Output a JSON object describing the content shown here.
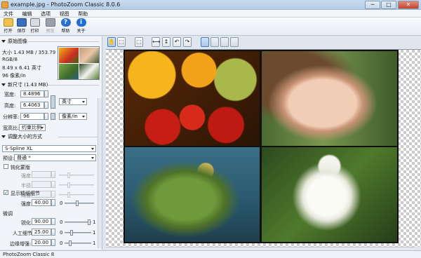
{
  "window": {
    "title": "example.jpg - PhotoZoom Classic 8.0.6",
    "min_glyph": "─",
    "max_glyph": "□",
    "close_glyph": "✕"
  },
  "menu": [
    "文件",
    "编辑",
    "选项",
    "视图",
    "帮助"
  ],
  "toolbar": {
    "open": "打开",
    "save": "保存",
    "print": "打印",
    "preview": "预览",
    "help": "帮助",
    "about": "关于",
    "help_glyph": "?",
    "about_glyph": "i"
  },
  "original_image": {
    "header": "原始图像",
    "size": "大小 1.43 MB / 353.79 KB",
    "mode": "RGB/8",
    "dimensions": "8.49 x 6.41 英寸",
    "resolution": "96 像素/in"
  },
  "new_size": {
    "header": "新尺寸 (1.43 MB)",
    "width_label": "宽度:",
    "width_value": "8.4896",
    "height_label": "高度:",
    "height_value": "6.4063",
    "resolution_label": "分辨率:",
    "resolution_value": "96",
    "unit": "英寸",
    "res_unit": "像素/in",
    "aspect_label": "宽高比:",
    "aspect_value": "约束比例"
  },
  "resize_method": {
    "header": "调整大小的方式",
    "method": "S-Spline XL",
    "preset_label": "预设:",
    "preset_value": "普通 *"
  },
  "sharpen": {
    "unsharp_label": "钝化蒙版",
    "strength_label": "强度:",
    "radius_label": "半径:",
    "threshold_label": "阈值:",
    "show_fine_detail_label": "显示精细细节",
    "fine_strength_label": "强度:",
    "fine_strength_value": "40.00",
    "fine_zero": "0",
    "tune_header": "微调",
    "sharpen_label": "锐化:",
    "sharpen_value": "90.00",
    "sharpen_zero": "0",
    "sharpen_one": "1",
    "artifact_label": "人工细节:",
    "artifact_value": "25.00",
    "artifact_zero": "0",
    "artifact_one": "1",
    "edge_label": "边缘增强:",
    "edge_value": "20.00",
    "edge_zero": "0",
    "edge_one": "1"
  },
  "view_tools": {
    "hand_glyph": "✋",
    "crop_glyph": "⬚",
    "fit_glyph": "⟷",
    "fitv_glyph": "↕",
    "undo_glyph": "↶",
    "redo_glyph": "↷"
  },
  "status": {
    "text": "PhotoZoom Classic 8"
  }
}
